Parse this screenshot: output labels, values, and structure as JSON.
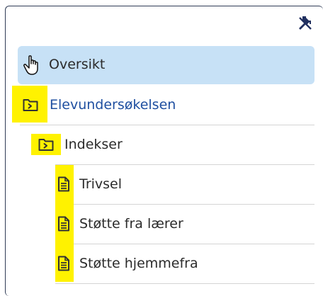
{
  "tree": {
    "pin_icon": "pin-icon",
    "items": [
      {
        "label": "Oversikt",
        "icon": "hand-pointer-icon",
        "selected": true
      },
      {
        "label": "Elevundersøkelsen",
        "icon": "folder-icon"
      },
      {
        "label": "Indekser",
        "icon": "folder-icon"
      },
      {
        "label": "Trivsel",
        "icon": "document-icon"
      },
      {
        "label": "Støtte fra lærer",
        "icon": "document-icon"
      },
      {
        "label": "Støtte hjemmefra",
        "icon": "document-icon"
      }
    ]
  },
  "colors": {
    "selected_bg": "#c7e1f6",
    "link": "#1f4fa0",
    "highlight": "#fff200",
    "border": "#2f3b55"
  }
}
